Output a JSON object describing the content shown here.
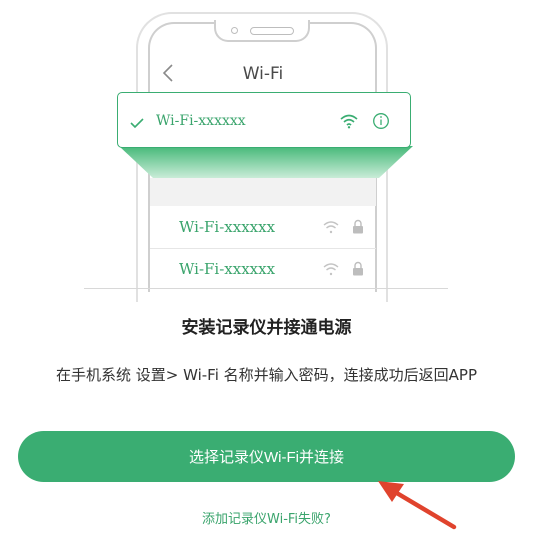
{
  "illustration": {
    "nav_title": "Wi-Fi",
    "selected_network": "Wi-Fi-xxxxxx",
    "networks": [
      {
        "name": "Wi-Fi-xxxxxx"
      },
      {
        "name": "Wi-Fi-xxxxxx"
      }
    ]
  },
  "heading": "安装记录仪并接通电源",
  "instruction": "在手机系统 设置> Wi-Fi 名称并输入密码，连接成功后返回APP",
  "connect_button_label": "选择记录仪Wi-Fi并连接",
  "help_link_label": "添加记录仪Wi-Fi失败?",
  "colors": {
    "accent": "#3aad72",
    "annotation_arrow": "#e0432d"
  }
}
